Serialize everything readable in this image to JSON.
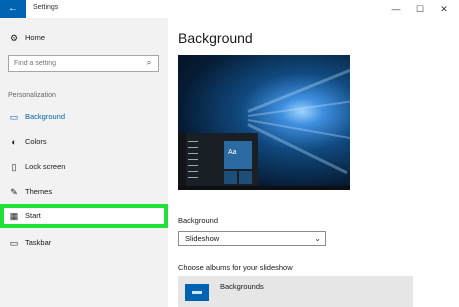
{
  "window": {
    "back_glyph": "←",
    "title": "Settings",
    "minimize_glyph": "—",
    "maximize_glyph": "☐",
    "close_glyph": "✕"
  },
  "sidebar": {
    "home": {
      "label": "Home",
      "icon": "gear-icon",
      "glyph": "⚙"
    },
    "search": {
      "placeholder": "Find a setting",
      "icon": "search-icon",
      "glyph": "⌕"
    },
    "section": "Personalization",
    "items": [
      {
        "label": "Background",
        "icon": "picture-icon",
        "glyph": "▭",
        "active": true
      },
      {
        "label": "Colors",
        "icon": "palette-icon",
        "glyph": "◐",
        "active": false
      },
      {
        "label": "Lock screen",
        "icon": "lock-screen-icon",
        "glyph": "▯",
        "active": false
      },
      {
        "label": "Themes",
        "icon": "brush-icon",
        "glyph": "✎",
        "active": false
      },
      {
        "label": "Start",
        "icon": "start-icon",
        "glyph": "▦",
        "active": false,
        "highlighted": true
      },
      {
        "label": "Taskbar",
        "icon": "taskbar-icon",
        "glyph": "▭",
        "active": false
      }
    ]
  },
  "main": {
    "title": "Background",
    "preview": {
      "tile_label": "Aa"
    },
    "background_label": "Background",
    "background_dropdown": {
      "value": "Slideshow",
      "chevron": "⌄"
    },
    "albums_label": "Choose albums for your slideshow",
    "album": {
      "label": "Backgrounds",
      "icon": "folder-icon"
    }
  },
  "colors": {
    "accent": "#0063b1",
    "highlight_border": "#22e03a",
    "sidebar_bg": "#f2f2f2"
  }
}
